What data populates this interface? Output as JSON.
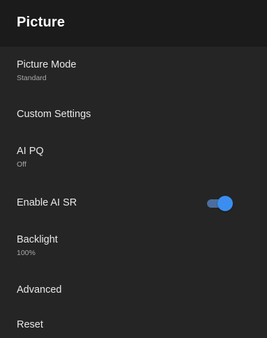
{
  "header": {
    "title": "Picture"
  },
  "menu": {
    "items": [
      {
        "title": "Picture Mode",
        "subtitle": "Standard"
      },
      {
        "title": "Custom Settings"
      },
      {
        "title": "AI PQ",
        "subtitle": "Off"
      },
      {
        "title": "Enable AI SR",
        "toggle": "on"
      },
      {
        "title": "Backlight",
        "subtitle": "100%"
      },
      {
        "title": "Advanced"
      },
      {
        "title": "Reset"
      }
    ]
  },
  "colors": {
    "header_bg": "#1b1b1b",
    "panel_bg": "#252525",
    "toggle_accent": "#3b8ef0"
  }
}
